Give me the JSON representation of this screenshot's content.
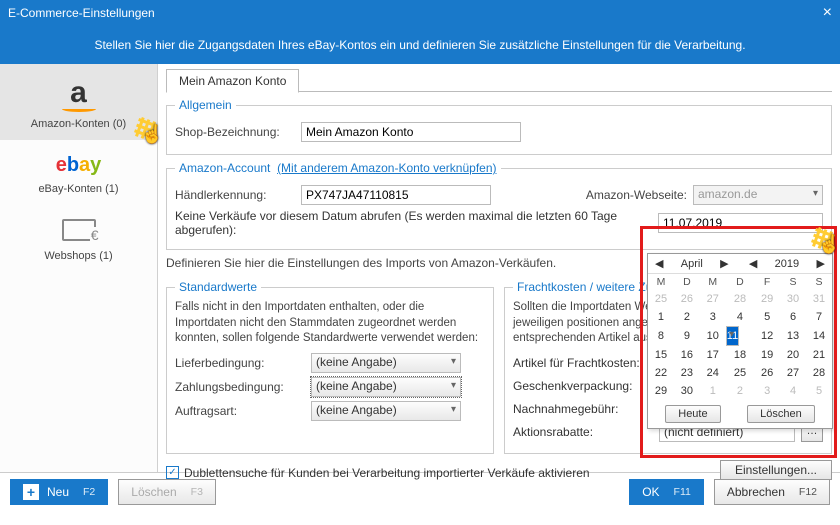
{
  "title": "E-Commerce-Einstellungen",
  "banner": "Stellen Sie hier die Zugangsdaten Ihres eBay-Kontos ein und definieren Sie zusätzliche Einstellungen für die Verarbeitung.",
  "sidebar": {
    "amazon": "Amazon-Konten (0)",
    "ebay": "eBay-Konten (1)",
    "webshops": "Webshops (1)"
  },
  "tab": "Mein Amazon Konto",
  "general": {
    "legend": "Allgemein",
    "shopLabel": "Shop-Bezeichnung:",
    "shopValue": "Mein Amazon Konto"
  },
  "account": {
    "legend": "Amazon-Account",
    "link": "(Mit anderem Amazon-Konto verknüpfen)",
    "merchantLabel": "Händlerkennung:",
    "merchantValue": "PX747JA47110815",
    "siteLabel": "Amazon-Webseite:",
    "siteValue": "amazon.de",
    "dateNote": "Keine Verkäufe vor diesem Datum abrufen (Es werden maximal die letzten 60 Tage abgerufen):",
    "dateValue": "11.07.2019"
  },
  "importNote": "Definieren Sie hier die Einstellungen des Imports von Amazon-Verkäufen.",
  "defaults": {
    "legend": "Standardwerte",
    "intro": "Falls nicht in den Importdaten enthalten, oder die Importdaten nicht den Stammdaten zugeordnet werden konnten, sollen folgende Standardwerte verwendet werden:",
    "ship": "Lieferbedingung:",
    "pay": "Zahlungsbedingung:",
    "order": "Auftragsart:",
    "none": "(keine Angabe)"
  },
  "freight": {
    "legend": "Frachtkosten / weitere Zuschläge",
    "intro": "Sollten die Importdaten Werte enthalten, wird an den jeweiligen positionen angelegt werden — wählen Sie hier die entsprechenden Artikel aus.",
    "art": "Artikel für Frachtkosten:",
    "gift": "Geschenkverpackung:",
    "cod": "Nachnahmegebühr:",
    "promo": "Aktionsrabatte:",
    "notdef": "(nicht definiert)"
  },
  "dup": "Dublettensuche für Kunden bei Verarbeitung importierter Verkäufe aktivieren",
  "settingsBtn": "Einstellungen...",
  "calendar": {
    "month": "April",
    "year": "2019",
    "dows": [
      "M",
      "D",
      "M",
      "D",
      "F",
      "S",
      "S"
    ],
    "weeks": [
      [
        {
          "d": 25,
          "off": true
        },
        {
          "d": 26,
          "off": true
        },
        {
          "d": 27,
          "off": true
        },
        {
          "d": 28,
          "off": true
        },
        {
          "d": 29,
          "off": true
        },
        {
          "d": 30,
          "off": true
        },
        {
          "d": 31,
          "off": true
        }
      ],
      [
        {
          "d": 1
        },
        {
          "d": 2
        },
        {
          "d": 3
        },
        {
          "d": 4
        },
        {
          "d": 5
        },
        {
          "d": 6
        },
        {
          "d": 7
        }
      ],
      [
        {
          "d": 8
        },
        {
          "d": 9
        },
        {
          "d": 10
        },
        {
          "d": 11,
          "sel": true
        },
        {
          "d": 12
        },
        {
          "d": 13
        },
        {
          "d": 14
        }
      ],
      [
        {
          "d": 15
        },
        {
          "d": 16
        },
        {
          "d": 17
        },
        {
          "d": 18
        },
        {
          "d": 19
        },
        {
          "d": 20
        },
        {
          "d": 21
        }
      ],
      [
        {
          "d": 22
        },
        {
          "d": 23
        },
        {
          "d": 24
        },
        {
          "d": 25
        },
        {
          "d": 26
        },
        {
          "d": 27
        },
        {
          "d": 28
        }
      ],
      [
        {
          "d": 29
        },
        {
          "d": 30
        },
        {
          "d": 1,
          "off": true
        },
        {
          "d": 2,
          "off": true
        },
        {
          "d": 3,
          "off": true
        },
        {
          "d": 4,
          "off": true
        },
        {
          "d": 5,
          "off": true
        }
      ]
    ],
    "today": "Heute",
    "clear": "Löschen"
  },
  "footer": {
    "new": "Neu",
    "newK": "F2",
    "del": "Löschen",
    "delK": "F3",
    "ok": "OK",
    "okK": "F11",
    "cancel": "Abbrechen",
    "cancelK": "F12"
  }
}
